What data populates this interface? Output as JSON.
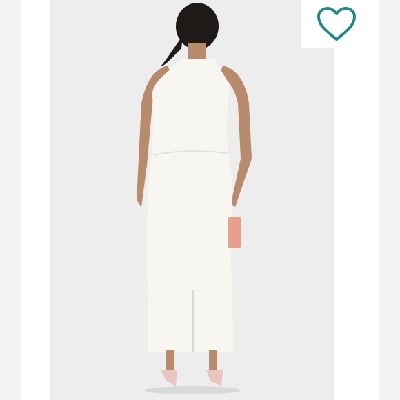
{
  "product_image": {
    "alt_subject": "model-back-view-white-halter-midi-dress",
    "background_color": "#ededed",
    "dress_color": "#f7f6f1",
    "clutch_color": "#e8a08c",
    "hair_color": "#1d1a18",
    "skin_color": "#b98b6d"
  },
  "like_button": {
    "icon": "heart-outline-icon",
    "color": "#1f8a8a"
  }
}
